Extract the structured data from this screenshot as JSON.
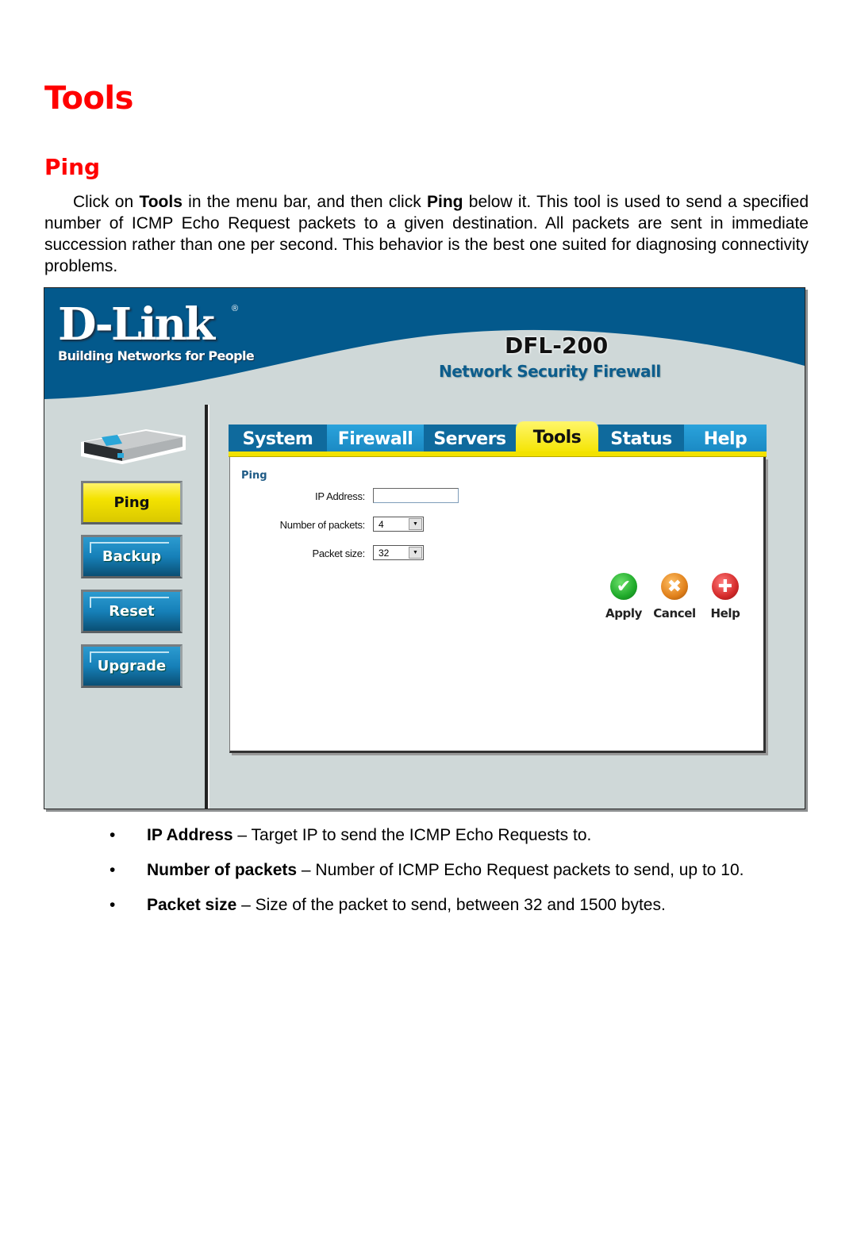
{
  "document": {
    "title": "Tools",
    "section": "Ping",
    "intro": {
      "p1": "Click on ",
      "b1": "Tools",
      "p2": " in the menu bar, and then click ",
      "b2": "Ping",
      "p3": " below it. This tool is used to send a specified number of ICMP Echo Request packets to a given destination. All packets are sent in immediate succession rather than one per second. This behavior is the best one suited for diagnosing connectivity problems."
    },
    "bullets": [
      {
        "term": "IP Address",
        "desc": " – Target IP to send the ICMP Echo Requests to."
      },
      {
        "term": "Number of packets",
        "desc": " – Number of ICMP Echo Request packets to send, up to 10."
      },
      {
        "term": "Packet size",
        "desc": " – Size of the packet to send, between 32 and 1500 bytes."
      }
    ],
    "bullet_glyph": "•"
  },
  "ui": {
    "brand": {
      "logo": "D-Link",
      "registered": "®",
      "tagline": "Building Networks for People",
      "model": "DFL-200",
      "product": "Network Security Firewall"
    },
    "colors": {
      "banner_blue": "#03598c",
      "heading_red": "#ff0000",
      "active_yellow": "#f4e400",
      "tab_blue": "#1a86c0"
    },
    "tabs": [
      {
        "label": "System",
        "active": false
      },
      {
        "label": "Firewall",
        "active": false
      },
      {
        "label": "Servers",
        "active": false
      },
      {
        "label": "Tools",
        "active": true
      },
      {
        "label": "Status",
        "active": false
      },
      {
        "label": "Help",
        "active": false
      }
    ],
    "side_menu": [
      {
        "label": "Ping",
        "active": true
      },
      {
        "label": "Backup",
        "active": false
      },
      {
        "label": "Reset",
        "active": false
      },
      {
        "label": "Upgrade",
        "active": false
      }
    ],
    "form": {
      "title": "Ping",
      "ip_label": "IP Address:",
      "ip_value": "",
      "packets_label": "Number of packets:",
      "packets_value": "4",
      "size_label": "Packet size:",
      "size_value": "32",
      "dropdown_glyph": "▼"
    },
    "actions": [
      {
        "label": "Apply",
        "icon": "check-icon",
        "glyph": "✔",
        "color": "#1faa2a"
      },
      {
        "label": "Cancel",
        "icon": "x-icon",
        "glyph": "✖",
        "color": "#e0801a"
      },
      {
        "label": "Help",
        "icon": "plus-icon",
        "glyph": "✚",
        "color": "#d42a2a"
      }
    ]
  }
}
